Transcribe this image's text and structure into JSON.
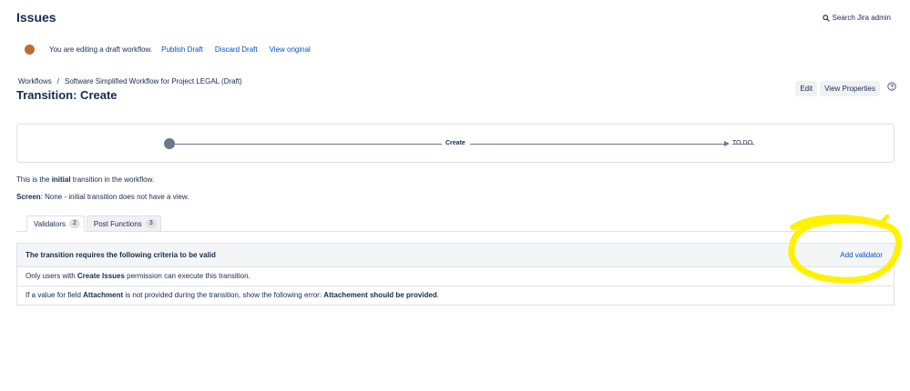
{
  "header": {
    "title": "Issues",
    "search_label": "Search Jira admin"
  },
  "draft_bar": {
    "message": "You are editing a draft workflow.",
    "publish_label": "Publish Draft",
    "discard_label": "Discard Draft",
    "original_label": "View original",
    "dot_color": "#c16a2e"
  },
  "breadcrumb": {
    "items": [
      "Workflows",
      "Software Simplified Workflow for Project LEGAL (Draft)"
    ],
    "separator": "/"
  },
  "page": {
    "heading": "Transition: Create",
    "edit_label": "Edit",
    "properties_label": "View Properties"
  },
  "diagram": {
    "transition_name": "Create",
    "target_status": "TO DO"
  },
  "info": {
    "line1_prefix": "This is the ",
    "line1_bold": "initial",
    "line1_suffix": " transition in the workflow.",
    "screen_label": "Screen",
    "screen_value": ": None - initial transition does not have a view."
  },
  "tabs": [
    {
      "label": "Validators",
      "count": "2"
    },
    {
      "label": "Post Functions",
      "count": "3"
    }
  ],
  "validators": {
    "header": "The transition requires the following criteria to be valid",
    "add_label": "Add validator",
    "row1": {
      "prefix": "Only users with ",
      "bold": "Create Issues",
      "suffix": " permission can execute this transition."
    },
    "row2": {
      "prefix": "If a value for field ",
      "bold1": "Attachment",
      "middle": " is not provided during the transition, show the following error: ",
      "bold2": "Attachement should be provided",
      "suffix": "."
    }
  },
  "colors": {
    "link": "#0052cc",
    "text": "#172b4d",
    "highlight": "#fff200"
  }
}
